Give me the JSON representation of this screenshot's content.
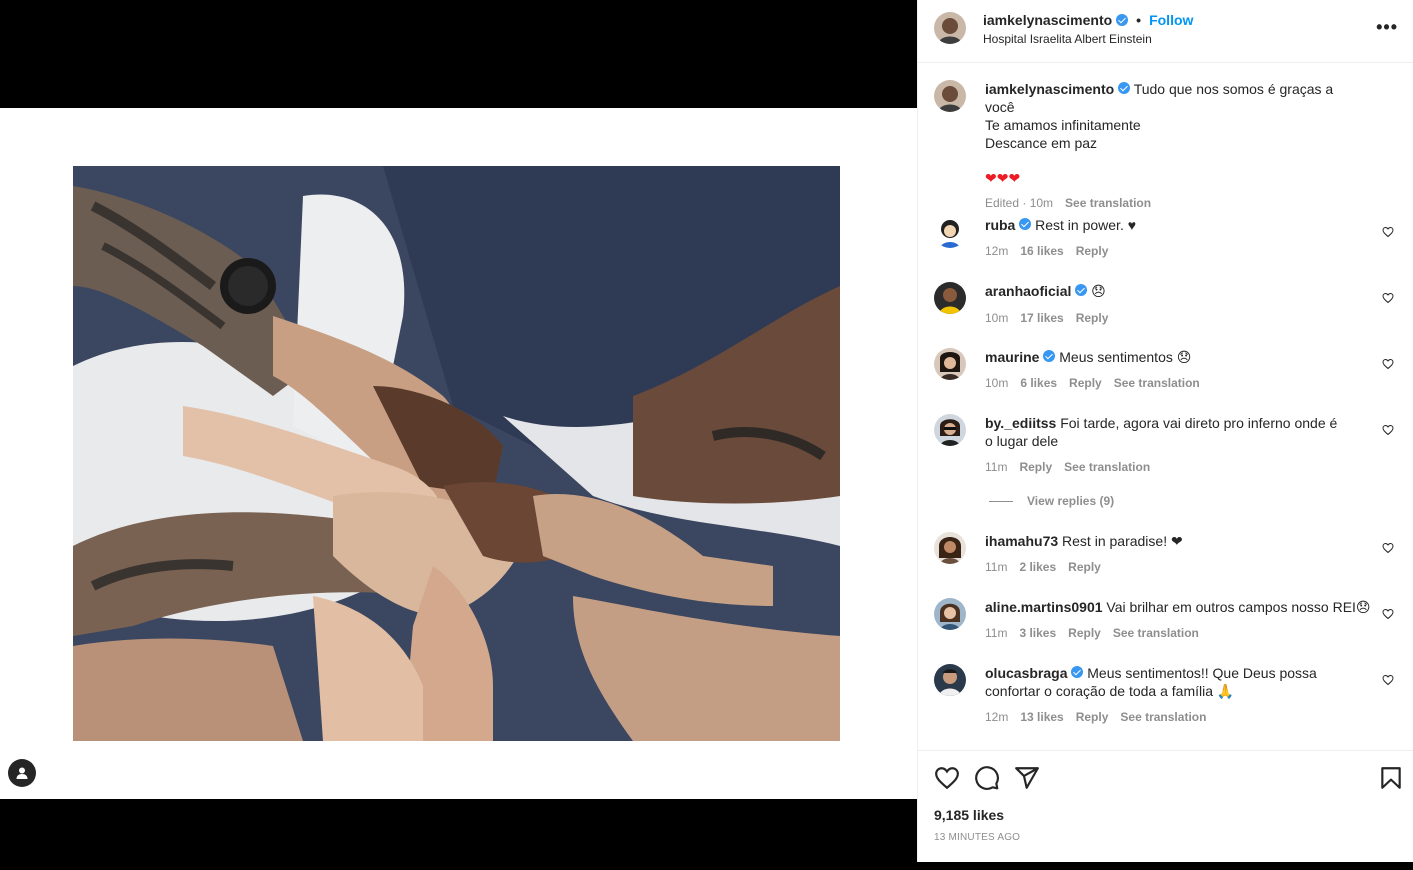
{
  "post": {
    "username": "iamkelynascimento",
    "follow_label": "Follow",
    "location": "Hospital Israelita Albert Einstein",
    "more_label": "•••",
    "caption": {
      "username": "iamkelynascimento",
      "line1": "Tudo que nos somos é graças a você",
      "line2": "Te amamos infinitamente",
      "line3": "Descance em paz",
      "hearts": "❤❤❤",
      "edited": "Edited · 10m",
      "see_translation": "See translation"
    },
    "likes": "9,185 likes",
    "time_ago": "13 MINUTES AGO"
  },
  "comments": [
    {
      "username": "ruba",
      "text": "Rest in power. ♥",
      "time": "12m",
      "likes": "16 likes",
      "reply": "Reply"
    },
    {
      "username": "aranhaoficial",
      "text": "😞",
      "time": "10m",
      "likes": "17 likes",
      "reply": "Reply"
    },
    {
      "username": "maurine",
      "text": "Meus sentimentos 😞",
      "time": "10m",
      "likes": "6 likes",
      "reply": "Reply",
      "see_translation": "See translation"
    },
    {
      "username": "by._ediitss",
      "text": "Foi tarde, agora vai direto pro inferno onde é o lugar dele",
      "time": "11m",
      "reply": "Reply",
      "see_translation": "See translation",
      "view_replies": "View replies (9)"
    },
    {
      "username": "ihamahu73",
      "text": "Rest in paradise! ❤",
      "time": "11m",
      "likes": "2 likes",
      "reply": "Reply"
    },
    {
      "username": "aline.martins0901",
      "text": "Vai brilhar em outros campos nosso REI😞",
      "time": "11m",
      "likes": "3 likes",
      "reply": "Reply",
      "see_translation": "See translation"
    },
    {
      "username": "olucasbraga",
      "text": "Meus sentimentos!! Que Deus possa confortar o coração de toda a família 🙏",
      "time": "12m",
      "likes": "13 likes",
      "reply": "Reply",
      "see_translation": "See translation"
    }
  ],
  "colors": {
    "accent": "#0095f6",
    "verified": "#3897f0",
    "muted": "#8e8e8e",
    "text": "#262626"
  },
  "icons": [
    "heart-icon",
    "comment-icon",
    "share-icon",
    "bookmark-icon",
    "user-tag-icon",
    "more-icon",
    "verified-icon"
  ]
}
